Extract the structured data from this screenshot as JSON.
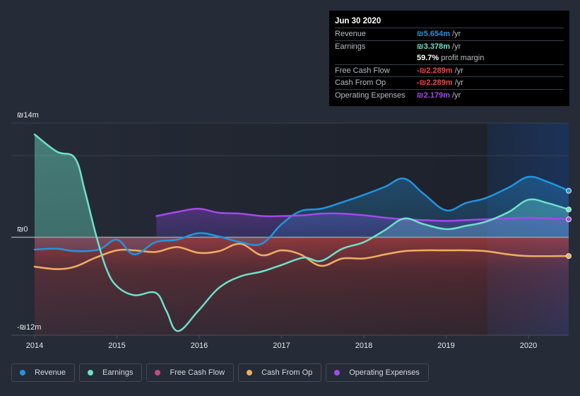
{
  "tooltip": {
    "date": "Jun 30 2020",
    "rows": [
      {
        "label": "Revenue",
        "value": "₪5.654m",
        "unit": "/yr",
        "color": "#2394df"
      },
      {
        "label": "Earnings",
        "value": "₪3.378m",
        "unit": "/yr",
        "color": "#6ee1c9"
      },
      {
        "label": "",
        "value": "59.7%",
        "unit": "profit margin",
        "color": "#ffffff"
      },
      {
        "label": "Free Cash Flow",
        "value": "-₪2.289m",
        "unit": "/yr",
        "color": "#e84a4a"
      },
      {
        "label": "Cash From Op",
        "value": "-₪2.289m",
        "unit": "/yr",
        "color": "#e84a4a"
      },
      {
        "label": "Operating Expenses",
        "value": "₪2.179m",
        "unit": "/yr",
        "color": "#a349ec"
      }
    ]
  },
  "legend": [
    {
      "label": "Revenue",
      "color": "#2394df"
    },
    {
      "label": "Earnings",
      "color": "#6ee1c9"
    },
    {
      "label": "Free Cash Flow",
      "color": "#c34a87"
    },
    {
      "label": "Cash From Op",
      "color": "#ecae5f"
    },
    {
      "label": "Operating Expenses",
      "color": "#a349ec"
    }
  ],
  "chart_data": {
    "type": "line",
    "title": "",
    "xlabel": "",
    "ylabel": "",
    "currency": "₪",
    "ylim": [
      -12,
      14
    ],
    "y_ticks": [
      {
        "value": 14,
        "label": "₪14m"
      },
      {
        "value": 0,
        "label": "₪0"
      },
      {
        "value": -12,
        "label": "-₪12m"
      }
    ],
    "x_ticks": [
      2014,
      2015,
      2016,
      2017,
      2018,
      2019,
      2020
    ],
    "x_range": [
      2013.73,
      2020.5
    ],
    "highlight_range": [
      2019.5,
      2020.5
    ],
    "grid": true,
    "legend_position": "bottom",
    "series": [
      {
        "name": "Revenue",
        "color": "#2394df",
        "x": [
          2014.0,
          2014.27,
          2014.49,
          2014.78,
          2015.0,
          2015.21,
          2015.47,
          2015.73,
          2015.99,
          2016.24,
          2016.5,
          2016.76,
          2017.0,
          2017.23,
          2017.48,
          2017.74,
          2018.0,
          2018.26,
          2018.49,
          2018.73,
          2019.0,
          2019.24,
          2019.48,
          2019.76,
          2020.0,
          2020.23,
          2020.49
        ],
        "values": [
          -1.5,
          -1.4,
          -1.7,
          -1.5,
          -0.3,
          -2.1,
          -0.6,
          -0.3,
          0.5,
          0.1,
          -0.6,
          -0.8,
          1.6,
          3.2,
          3.5,
          4.3,
          5.2,
          6.2,
          7.2,
          5.3,
          3.3,
          4.2,
          4.8,
          6.1,
          7.4,
          6.8,
          5.7
        ]
      },
      {
        "name": "Earnings",
        "color": "#6ee1c9",
        "x": [
          2014.0,
          2014.27,
          2014.49,
          2014.61,
          2014.74,
          2014.87,
          2015.0,
          2015.21,
          2015.47,
          2015.6,
          2015.74,
          2015.99,
          2016.24,
          2016.5,
          2016.76,
          2017.0,
          2017.27,
          2017.48,
          2017.74,
          2018.0,
          2018.26,
          2018.49,
          2018.73,
          2019.0,
          2019.24,
          2019.48,
          2019.76,
          2020.0,
          2020.23,
          2020.49
        ],
        "values": [
          12.6,
          10.5,
          9.7,
          5.7,
          0.5,
          -3.8,
          -6.0,
          -7.1,
          -6.8,
          -9.0,
          -11.5,
          -9.0,
          -6.2,
          -4.8,
          -4.2,
          -3.4,
          -2.5,
          -2.9,
          -1.4,
          -0.6,
          0.9,
          2.3,
          1.6,
          1.0,
          1.4,
          1.9,
          3.1,
          4.6,
          4.2,
          3.4
        ]
      },
      {
        "name": "Free Cash Flow",
        "color": "#c34a87",
        "x": [
          2014.0,
          2014.27,
          2014.49,
          2014.74,
          2015.0,
          2015.21,
          2015.47,
          2015.73,
          2015.99,
          2016.24,
          2016.5,
          2016.76,
          2017.0,
          2017.23,
          2017.48,
          2017.74,
          2018.0,
          2018.26,
          2018.49,
          2018.73,
          2019.0,
          2019.24,
          2019.48,
          2019.76,
          2020.0,
          2020.49
        ],
        "values": [
          -3.6,
          -3.9,
          -3.6,
          -2.5,
          -1.6,
          -1.6,
          -1.8,
          -1.2,
          -1.9,
          -1.7,
          -0.8,
          -2.2,
          -1.6,
          -2.1,
          -3.5,
          -2.6,
          -2.6,
          -2.1,
          -1.7,
          -1.6,
          -1.6,
          -1.6,
          -1.7,
          -2.1,
          -2.3,
          -2.3
        ]
      },
      {
        "name": "Cash From Op",
        "color": "#ecae5f",
        "x": [
          2014.0,
          2014.27,
          2014.49,
          2014.74,
          2015.0,
          2015.21,
          2015.47,
          2015.73,
          2015.99,
          2016.24,
          2016.5,
          2016.76,
          2017.0,
          2017.23,
          2017.48,
          2017.74,
          2018.0,
          2018.26,
          2018.49,
          2018.73,
          2019.0,
          2019.24,
          2019.48,
          2019.76,
          2020.0,
          2020.49
        ],
        "values": [
          -3.6,
          -3.9,
          -3.6,
          -2.5,
          -1.6,
          -1.6,
          -1.8,
          -1.2,
          -1.9,
          -1.7,
          -0.8,
          -2.2,
          -1.6,
          -2.1,
          -3.5,
          -2.6,
          -2.6,
          -2.1,
          -1.7,
          -1.6,
          -1.6,
          -1.6,
          -1.7,
          -2.1,
          -2.3,
          -2.3
        ]
      },
      {
        "name": "Operating Expenses",
        "color": "#a349ec",
        "x": [
          2015.48,
          2015.73,
          2015.99,
          2016.24,
          2016.5,
          2016.76,
          2017.0,
          2017.27,
          2017.48,
          2017.74,
          2018.0,
          2018.26,
          2018.49,
          2018.73,
          2019.0,
          2019.24,
          2019.48,
          2019.76,
          2020.0,
          2020.49
        ],
        "values": [
          2.6,
          3.1,
          3.5,
          3.0,
          2.9,
          2.6,
          2.6,
          2.7,
          2.9,
          2.9,
          2.7,
          2.4,
          2.2,
          2.1,
          2.0,
          2.1,
          2.2,
          2.3,
          2.4,
          2.2
        ]
      }
    ]
  }
}
